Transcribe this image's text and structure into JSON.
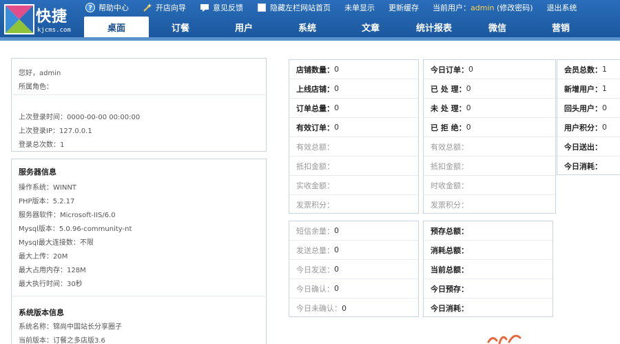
{
  "logo": {
    "text": "快捷",
    "sub": "kjcms.com"
  },
  "topbar": {
    "items": [
      {
        "label": "帮助中心",
        "icon": "help-icon"
      },
      {
        "label": "开店向导",
        "icon": "wand-icon"
      },
      {
        "label": "意见反馈",
        "icon": "feedback-icon"
      },
      {
        "label": "隐藏左栏",
        "icon": "checkbox-icon"
      },
      {
        "label": "网站首页"
      },
      {
        "label": "未单显示"
      },
      {
        "label": "更新缓存"
      }
    ],
    "current_user_label": "当前用户：",
    "username": "admin",
    "change_password": "(修改密码)",
    "logout": "退出系统"
  },
  "nav": {
    "tabs": [
      "桌面",
      "订餐",
      "用户",
      "系统",
      "文章",
      "统计报表",
      "微信",
      "营销"
    ],
    "active": 0
  },
  "welcome": {
    "greeting": "您好，admin",
    "role": "所属角色：",
    "last_login_time": "上次登录时间：0000-00-00 00:00:00",
    "last_login_ip": "上次登录IP：127.0.0.1",
    "login_count": "登录总次数：1"
  },
  "server": {
    "title": "服务器信息",
    "lines": [
      "操作系统：WINNT",
      "PHP版本：5.2.17",
      "服务器软件：Microsoft-IIS/6.0",
      "Mysql版本：5.0.96-community-nt",
      "Mysql最大连接数：不限",
      "最大上传：20M",
      "最大占用内存：128M",
      "最大执行时间：30秒"
    ]
  },
  "version": {
    "title": "系统版本信息",
    "lines": [
      "系统名称：锦尚中国站长分享圈子",
      "当前版本：订餐之多店版3.6"
    ]
  },
  "stats_shop": [
    {
      "label": "店铺数量：",
      "value": "0",
      "dim": false
    },
    {
      "label": "上线店铺：",
      "value": "0",
      "dim": false
    },
    {
      "label": "订单总量：",
      "value": "0",
      "dim": false
    },
    {
      "label": "有效订单：",
      "value": "0",
      "dim": false
    },
    {
      "label": "有效总额：",
      "value": "",
      "dim": true
    },
    {
      "label": "抵扣金额：",
      "value": "",
      "dim": true
    },
    {
      "label": "实收金额：",
      "value": "",
      "dim": true
    },
    {
      "label": "发票积分：",
      "value": "",
      "dim": true
    }
  ],
  "stats_today": [
    {
      "label": "今日订单：",
      "value": "0",
      "dim": false
    },
    {
      "label": "已 处 理：",
      "value": "0",
      "dim": false
    },
    {
      "label": "未 处 理：",
      "value": "0",
      "dim": false
    },
    {
      "label": "已 拒 绝：",
      "value": "0",
      "dim": false
    },
    {
      "label": "有效总额：",
      "value": "",
      "dim": true
    },
    {
      "label": "抵扣金额：",
      "value": "",
      "dim": true
    },
    {
      "label": "时收金额：",
      "value": "",
      "dim": true
    },
    {
      "label": "发票积分：",
      "value": "",
      "dim": true
    }
  ],
  "stats_member": [
    {
      "label": "会员总数：",
      "value": "1",
      "dim": false
    },
    {
      "label": "新增用户：",
      "value": "1",
      "dim": false
    },
    {
      "label": "回头用户：",
      "value": "0",
      "dim": false
    },
    {
      "label": "用户积分：",
      "value": "0",
      "dim": false
    },
    {
      "label": "今日送出：",
      "value": "",
      "dim": false
    },
    {
      "label": "今日消耗：",
      "value": "",
      "dim": false
    }
  ],
  "stats_sms": [
    {
      "label": "短信余量：",
      "value": "0",
      "dim": true
    },
    {
      "label": "发送总量：",
      "value": "0",
      "dim": true
    },
    {
      "label": "今日发送：",
      "value": "0",
      "dim": true
    },
    {
      "label": "今日确认：",
      "value": "0",
      "dim": true
    },
    {
      "label": "今日未确认：",
      "value": "0",
      "dim": true
    }
  ],
  "stats_prepay": [
    {
      "label": "预存总额：",
      "value": "",
      "dim": false
    },
    {
      "label": "消耗总额：",
      "value": "",
      "dim": false
    },
    {
      "label": "当前总额：",
      "value": "",
      "dim": false
    },
    {
      "label": "今日预存：",
      "value": "",
      "dim": false
    },
    {
      "label": "今日消耗：",
      "value": "",
      "dim": false
    }
  ],
  "colors": {
    "header": "#1d5fa8",
    "username": "#ffd24a",
    "panel_border": "#c8d4e4"
  }
}
